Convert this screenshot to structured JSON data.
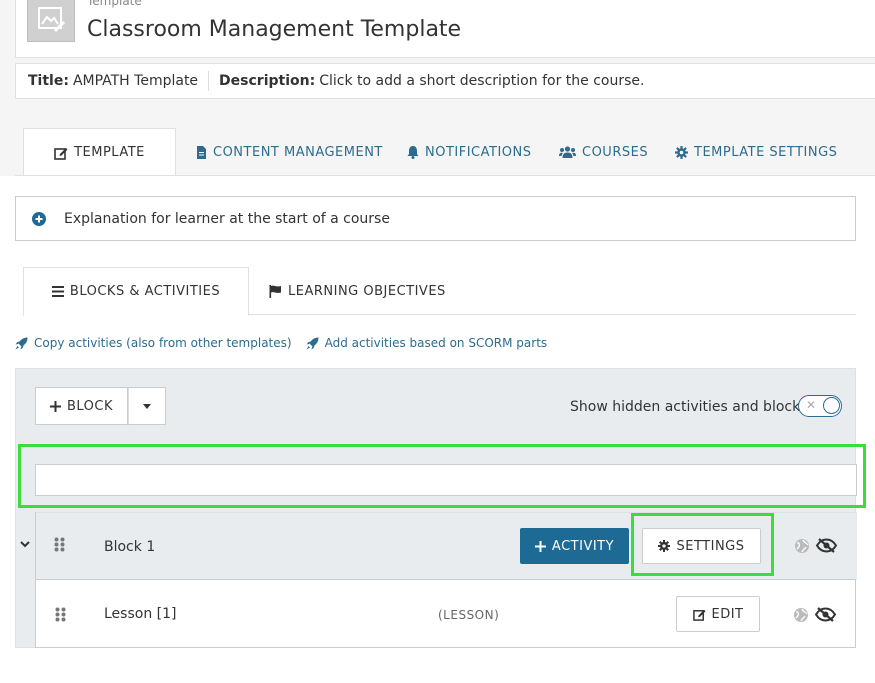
{
  "header": {
    "supertitle": "Template",
    "title": "Classroom Management Template"
  },
  "infobar": {
    "title_label": "Title:",
    "title_value": "AMPATH Template",
    "description_label": "Description:",
    "description_value": "Click to add a short description for the course."
  },
  "tabs": [
    {
      "label": "TEMPLATE",
      "icon": "edit-icon",
      "active": true
    },
    {
      "label": "CONTENT MANAGEMENT",
      "icon": "file-icon",
      "active": false
    },
    {
      "label": "NOTIFICATIONS",
      "icon": "bell-icon",
      "active": false
    },
    {
      "label": "COURSES",
      "icon": "users-icon",
      "active": false
    },
    {
      "label": "TEMPLATE SETTINGS",
      "icon": "gear-icon",
      "active": false
    }
  ],
  "explanation": "Explanation for learner at the start of a course",
  "subtabs": [
    {
      "label": "BLOCKS & ACTIVITIES",
      "icon": "list-icon",
      "active": true
    },
    {
      "label": "LEARNING OBJECTIVES",
      "icon": "flag-icon",
      "active": false
    }
  ],
  "links": {
    "copy": "Copy activities (also from other templates)",
    "scorm": "Add activities based on SCORM parts"
  },
  "toolbar": {
    "block_label": "BLOCK",
    "toggle_label": "Show hidden activities and blocks"
  },
  "block": {
    "title": "Block 1",
    "activity_label": "ACTIVITY",
    "settings_label": "SETTINGS"
  },
  "lesson": {
    "title": "Lesson [1]",
    "type": "(LESSON)",
    "edit_label": "EDIT"
  },
  "colors": {
    "accent": "#1d6a94",
    "link": "#2b6c8f",
    "highlight": "#3ddc3d"
  }
}
